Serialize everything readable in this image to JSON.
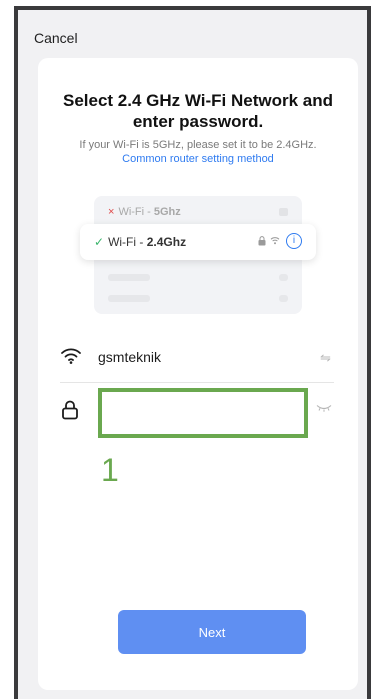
{
  "header": {
    "cancel_label": "Cancel"
  },
  "main": {
    "title": "Select 2.4 GHz Wi-Fi Network and enter password.",
    "hint": "If your Wi-Fi is 5GHz, please set it to be 2.4GHz.",
    "router_link": "Common router setting method"
  },
  "illustration": {
    "bad_option": {
      "mark": "×",
      "prefix": "Wi-Fi - ",
      "band": "5Ghz"
    },
    "good_option": {
      "mark": "✓",
      "prefix": "Wi-Fi - ",
      "band": "2.4Ghz",
      "info_glyph": "i"
    }
  },
  "network": {
    "ssid": "gsmteknik",
    "switch_icon": "swap-arrows-icon",
    "password_value": "",
    "password_placeholder": ""
  },
  "annotation": {
    "number": "1",
    "color": "#6aa84f"
  },
  "footer": {
    "next_label": "Next"
  },
  "colors": {
    "accent_button": "#5f8ff2",
    "link": "#2f7bf0",
    "check": "#3bb56c",
    "cross": "#e04848",
    "highlight": "#6aa84f"
  }
}
